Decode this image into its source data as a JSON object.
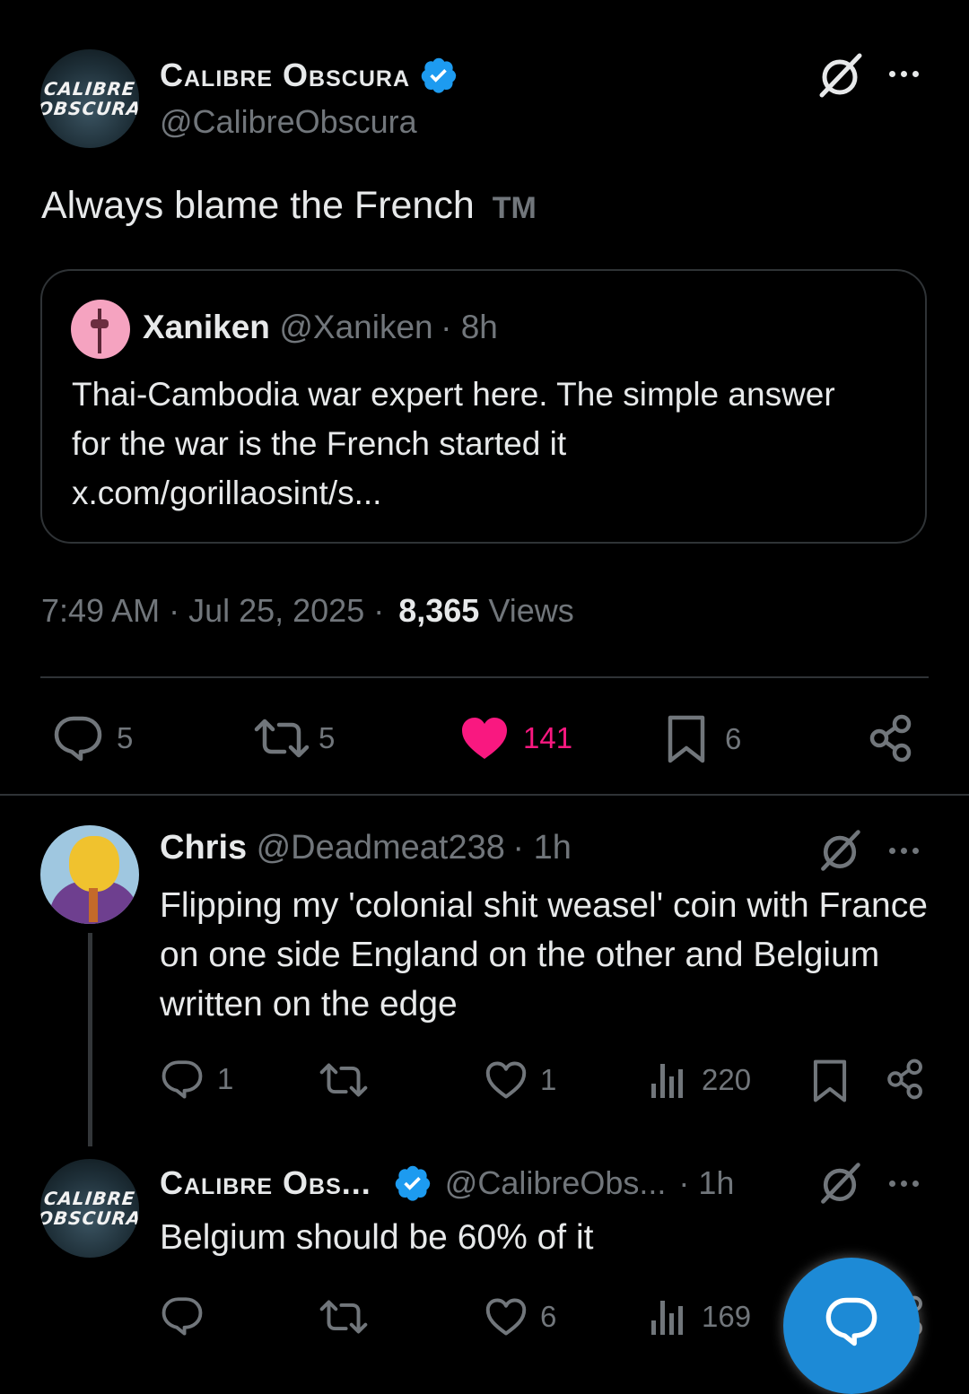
{
  "main_tweet": {
    "display_name": "Calibre Obscura",
    "handle": "@CalibreObscura",
    "avatar_text": [
      "CALIBRE",
      "OBSCURA"
    ],
    "text": "Always blame the French",
    "tm": "TM",
    "quoted": {
      "name": "Xaniken",
      "handle": "@Xaniken",
      "time": "· 8h",
      "text": "Thai-Cambodia war expert here. The simple answer for the war is the French started it x.com/gorillaosint/s..."
    },
    "timestamp": "7:49 AM · Jul 25, 2025 ·",
    "views_count": "8,365",
    "views_label": "Views",
    "actions": {
      "replies": "5",
      "reposts": "5",
      "likes": "141",
      "bookmarks": "6"
    }
  },
  "replies": [
    {
      "display_name": "Chris",
      "handle": "@Deadmeat238",
      "time": "· 1h",
      "text": "Flipping my 'colonial shit weasel' coin with France on one side England on the other and Belgium written on the edge",
      "actions": {
        "replies": "1",
        "reposts": "",
        "likes": "1",
        "views": "220"
      }
    },
    {
      "display_name": "Calibre Obs...",
      "handle": "@CalibreObs...",
      "time": "· 1h",
      "text": "Belgium should be 60% of it",
      "actions": {
        "replies": "",
        "reposts": "",
        "likes": "6",
        "views": "169"
      }
    }
  ],
  "colors": {
    "like_active": "#f91880",
    "verified": "#1d9bf0",
    "fab": "#1d8ad6",
    "muted": "#71767b"
  },
  "icons": [
    "grok-icon",
    "more-icon",
    "reply-icon",
    "repost-icon",
    "heart-icon",
    "bookmark-icon",
    "share-icon",
    "views-icon",
    "compose-reply-icon"
  ]
}
